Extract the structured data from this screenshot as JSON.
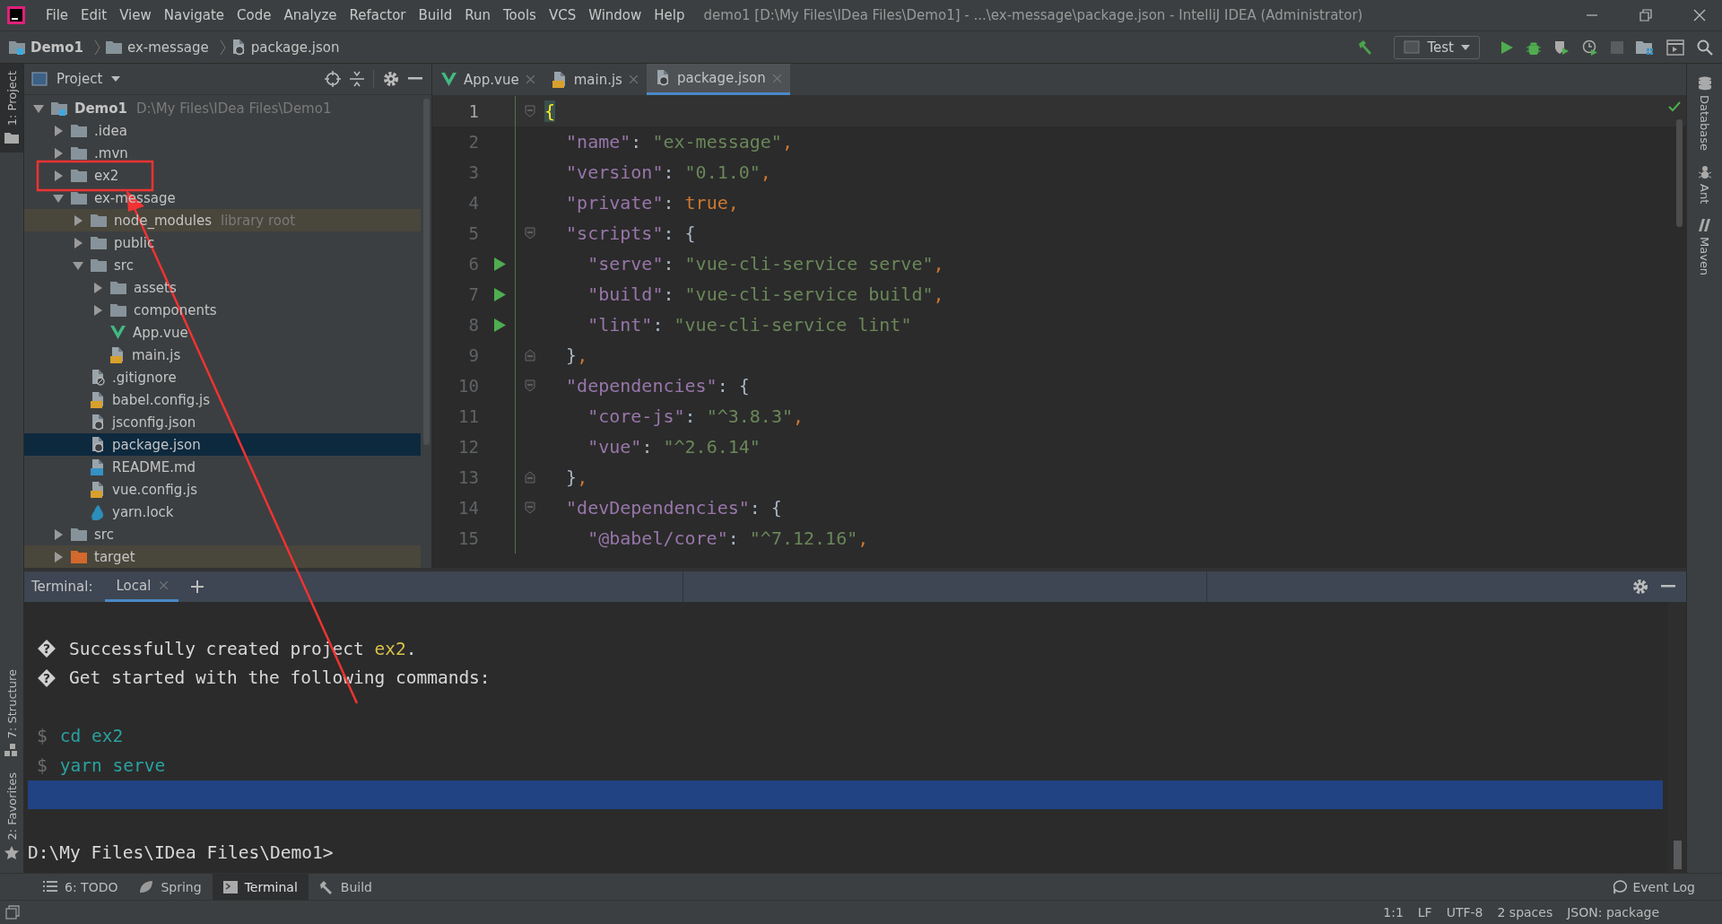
{
  "window": {
    "title": "demo1 [D:\\My Files\\IDea Files\\Demo1] - ...\\ex-message\\package.json - IntelliJ IDEA (Administrator)"
  },
  "menu": [
    "File",
    "Edit",
    "View",
    "Navigate",
    "Code",
    "Analyze",
    "Refactor",
    "Build",
    "Run",
    "Tools",
    "VCS",
    "Window",
    "Help"
  ],
  "breadcrumbs": [
    {
      "label": "Demo1",
      "kind": "project"
    },
    {
      "label": "ex-message",
      "kind": "folder"
    },
    {
      "label": "package.json",
      "kind": "json"
    }
  ],
  "toolbar": {
    "run_config": "Test"
  },
  "left_stripe": [
    {
      "label": "1: Project",
      "kind": "project",
      "selected": true
    },
    {
      "label": "7: Structure",
      "kind": "structure",
      "selected": false
    },
    {
      "label": "2: Favorites",
      "kind": "favorites",
      "selected": false
    }
  ],
  "right_stripe": [
    {
      "label": "Database",
      "kind": "database"
    },
    {
      "label": "Ant",
      "kind": "ant"
    },
    {
      "label": "Maven",
      "kind": "maven"
    }
  ],
  "project_panel": {
    "title": "Project",
    "tree": [
      {
        "label": "Demo1",
        "kind": "project",
        "hint": "D:\\My Files\\IDea Files\\Demo1",
        "expanded": true,
        "selected": false,
        "tinted": false,
        "children": [
          {
            "label": ".idea",
            "kind": "folder",
            "expanded": false,
            "selected": false,
            "tinted": false
          },
          {
            "label": ".mvn",
            "kind": "folder",
            "expanded": false,
            "selected": false,
            "tinted": false
          },
          {
            "label": "ex2",
            "kind": "folder",
            "expanded": false,
            "selected": false,
            "tinted": false
          },
          {
            "label": "ex-message",
            "kind": "folder",
            "expanded": true,
            "selected": false,
            "tinted": false,
            "children": [
              {
                "label": "node_modules",
                "kind": "folder",
                "hint": "library root",
                "expanded": false,
                "selected": false,
                "tinted": true
              },
              {
                "label": "public",
                "kind": "folder",
                "expanded": false,
                "selected": false,
                "tinted": false
              },
              {
                "label": "src",
                "kind": "folder",
                "expanded": true,
                "selected": false,
                "tinted": false,
                "children": [
                  {
                    "label": "assets",
                    "kind": "folder",
                    "expanded": false,
                    "selected": false,
                    "tinted": false
                  },
                  {
                    "label": "components",
                    "kind": "folder",
                    "expanded": false,
                    "selected": false,
                    "tinted": false
                  },
                  {
                    "label": "App.vue",
                    "kind": "vue",
                    "selected": false,
                    "tinted": false
                  },
                  {
                    "label": "main.js",
                    "kind": "js",
                    "selected": false,
                    "tinted": false
                  }
                ]
              },
              {
                "label": ".gitignore",
                "kind": "git",
                "selected": false,
                "tinted": false
              },
              {
                "label": "babel.config.js",
                "kind": "js",
                "selected": false,
                "tinted": false
              },
              {
                "label": "jsconfig.json",
                "kind": "json",
                "selected": false,
                "tinted": false
              },
              {
                "label": "package.json",
                "kind": "json",
                "selected": true,
                "tinted": false
              },
              {
                "label": "README.md",
                "kind": "md",
                "selected": false,
                "tinted": false
              },
              {
                "label": "vue.config.js",
                "kind": "js",
                "selected": false,
                "tinted": false
              },
              {
                "label": "yarn.lock",
                "kind": "yarn",
                "selected": false,
                "tinted": false
              }
            ]
          },
          {
            "label": "src",
            "kind": "folder",
            "expanded": false,
            "selected": false,
            "tinted": false
          },
          {
            "label": "target",
            "kind": "excluded",
            "expanded": false,
            "selected": false,
            "tinted": true
          }
        ]
      }
    ]
  },
  "editor": {
    "tabs": [
      {
        "label": "App.vue",
        "kind": "vue",
        "selected": false
      },
      {
        "label": "main.js",
        "kind": "js",
        "selected": false
      },
      {
        "label": "package.json",
        "kind": "json",
        "selected": true
      }
    ],
    "lines": [
      {
        "number": "1",
        "current": true,
        "run": false,
        "fold_start": true,
        "fold_end": false,
        "tokens": [
          {
            "text": "{",
            "kind": "match"
          }
        ]
      },
      {
        "number": "2",
        "current": false,
        "run": false,
        "fold_start": false,
        "fold_end": false,
        "tokens": [
          {
            "text": "  \"name\"",
            "kind": "key"
          },
          {
            "text": ": ",
            "kind": "punct"
          },
          {
            "text": "\"ex-message\"",
            "kind": "str"
          },
          {
            "text": ",",
            "kind": "comma"
          }
        ]
      },
      {
        "number": "3",
        "current": false,
        "run": false,
        "fold_start": false,
        "fold_end": false,
        "tokens": [
          {
            "text": "  \"version\"",
            "kind": "key"
          },
          {
            "text": ": ",
            "kind": "punct"
          },
          {
            "text": "\"0.1.0\"",
            "kind": "str"
          },
          {
            "text": ",",
            "kind": "comma"
          }
        ]
      },
      {
        "number": "4",
        "current": false,
        "run": false,
        "fold_start": false,
        "fold_end": false,
        "tokens": [
          {
            "text": "  \"private\"",
            "kind": "key"
          },
          {
            "text": ": ",
            "kind": "punct"
          },
          {
            "text": "true",
            "kind": "kw"
          },
          {
            "text": ",",
            "kind": "comma"
          }
        ]
      },
      {
        "number": "5",
        "current": false,
        "run": false,
        "fold_start": true,
        "fold_end": false,
        "tokens": [
          {
            "text": "  \"scripts\"",
            "kind": "key"
          },
          {
            "text": ": {",
            "kind": "punct"
          }
        ]
      },
      {
        "number": "6",
        "current": false,
        "run": true,
        "fold_start": false,
        "fold_end": false,
        "tokens": [
          {
            "text": "    \"serve\"",
            "kind": "key"
          },
          {
            "text": ": ",
            "kind": "punct"
          },
          {
            "text": "\"vue-cli-service serve\"",
            "kind": "str"
          },
          {
            "text": ",",
            "kind": "comma"
          }
        ]
      },
      {
        "number": "7",
        "current": false,
        "run": true,
        "fold_start": false,
        "fold_end": false,
        "tokens": [
          {
            "text": "    \"build\"",
            "kind": "key"
          },
          {
            "text": ": ",
            "kind": "punct"
          },
          {
            "text": "\"vue-cli-service build\"",
            "kind": "str"
          },
          {
            "text": ",",
            "kind": "comma"
          }
        ]
      },
      {
        "number": "8",
        "current": false,
        "run": true,
        "fold_start": false,
        "fold_end": false,
        "tokens": [
          {
            "text": "    \"lint\"",
            "kind": "key"
          },
          {
            "text": ": ",
            "kind": "punct"
          },
          {
            "text": "\"vue-cli-service lint\"",
            "kind": "str"
          }
        ]
      },
      {
        "number": "9",
        "current": false,
        "run": false,
        "fold_start": false,
        "fold_end": true,
        "tokens": [
          {
            "text": "  }",
            "kind": "punct"
          },
          {
            "text": ",",
            "kind": "comma"
          }
        ]
      },
      {
        "number": "10",
        "current": false,
        "run": false,
        "fold_start": true,
        "fold_end": false,
        "tokens": [
          {
            "text": "  \"dependencies\"",
            "kind": "key"
          },
          {
            "text": ": {",
            "kind": "punct"
          }
        ]
      },
      {
        "number": "11",
        "current": false,
        "run": false,
        "fold_start": false,
        "fold_end": false,
        "tokens": [
          {
            "text": "    \"core-js\"",
            "kind": "key"
          },
          {
            "text": ": ",
            "kind": "punct"
          },
          {
            "text": "\"^3.8.3\"",
            "kind": "str"
          },
          {
            "text": ",",
            "kind": "comma"
          }
        ]
      },
      {
        "number": "12",
        "current": false,
        "run": false,
        "fold_start": false,
        "fold_end": false,
        "tokens": [
          {
            "text": "    \"vue\"",
            "kind": "key"
          },
          {
            "text": ": ",
            "kind": "punct"
          },
          {
            "text": "\"^2.6.14\"",
            "kind": "str"
          }
        ]
      },
      {
        "number": "13",
        "current": false,
        "run": false,
        "fold_start": false,
        "fold_end": true,
        "tokens": [
          {
            "text": "  }",
            "kind": "punct"
          },
          {
            "text": ",",
            "kind": "comma"
          }
        ]
      },
      {
        "number": "14",
        "current": false,
        "run": false,
        "fold_start": true,
        "fold_end": false,
        "tokens": [
          {
            "text": "  \"devDependencies\"",
            "kind": "key"
          },
          {
            "text": ": {",
            "kind": "punct"
          }
        ]
      },
      {
        "number": "15",
        "current": false,
        "run": false,
        "fold_start": false,
        "fold_end": false,
        "tokens": [
          {
            "text": "    \"@babel/core\"",
            "kind": "key"
          },
          {
            "text": ": ",
            "kind": "punct"
          },
          {
            "text": "\"^7.12.16\"",
            "kind": "str"
          },
          {
            "text": ",",
            "kind": "comma"
          }
        ]
      }
    ]
  },
  "terminal": {
    "title": "Terminal:",
    "tabs": [
      {
        "label": "Local",
        "selected": true
      }
    ],
    "lines": [
      {
        "kind": "message",
        "marker": "?",
        "parts": [
          {
            "text": "Successfully created project ",
            "kind": "plain"
          },
          {
            "text": "ex2",
            "kind": "name"
          },
          {
            "text": ".",
            "kind": "plain"
          }
        ]
      },
      {
        "kind": "message",
        "marker": "?",
        "parts": [
          {
            "text": "Get started with the following commands:",
            "kind": "plain"
          }
        ]
      },
      {
        "kind": "blank"
      },
      {
        "kind": "command",
        "prompt": "$",
        "text": "cd ex2"
      },
      {
        "kind": "command",
        "prompt": "$",
        "text": "yarn serve"
      },
      {
        "kind": "selection"
      },
      {
        "kind": "blank"
      },
      {
        "kind": "prompt",
        "text": "D:\\My Files\\IDea Files\\Demo1>"
      }
    ]
  },
  "tool_tabs": [
    {
      "label": "6: TODO",
      "kind": "todo",
      "selected": false
    },
    {
      "label": "Spring",
      "kind": "spring",
      "selected": false
    },
    {
      "label": "Terminal",
      "kind": "terminal",
      "selected": true
    },
    {
      "label": "Build",
      "kind": "build",
      "selected": false
    }
  ],
  "event_log": "Event Log",
  "status_bar": [
    "1:1",
    "LF",
    "UTF-8",
    "2 spaces",
    "JSON: package"
  ]
}
